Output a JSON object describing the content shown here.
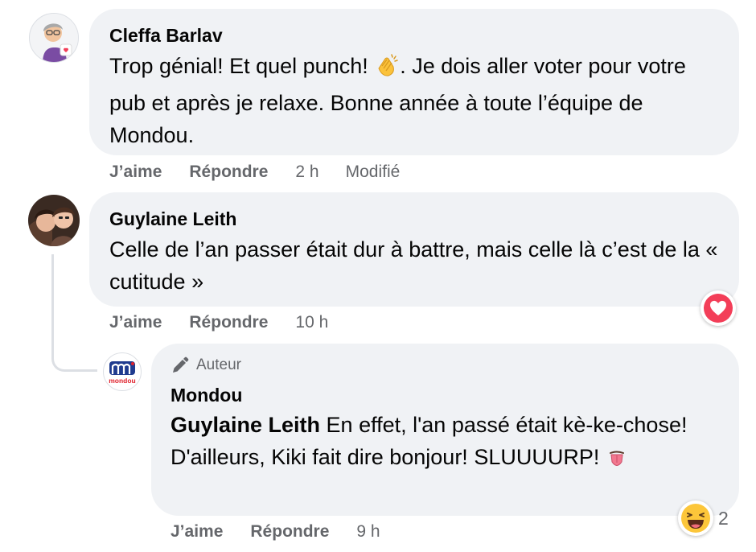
{
  "comments": [
    {
      "author": "Cleffa Barlav",
      "text_parts": [
        "Trop génial! Et quel punch! ",
        ". Je dois aller voter pour votre pub et après je relaxe. Bonne année à toute l’équipe de Mondou."
      ],
      "inline_emoji": "clapping-hands",
      "like_label": "J’aime",
      "reply_label": "Répondre",
      "time": "2 h",
      "edited_label": "Modifié"
    },
    {
      "author": "Guylaine Leith",
      "text": "Celle de l’an passer était dur à battre, mais celle là c’est de la « cutitude »",
      "like_label": "J’aime",
      "reply_label": "Répondre",
      "time": "10 h",
      "reaction": "heart"
    }
  ],
  "reply": {
    "badge_icon": "pencil-icon",
    "badge_label": "Auteur",
    "author": "Mondou",
    "logo_text": "mondou",
    "mention": "Guylaine Leith",
    "text_parts": [
      " En effet, l'an passé était kè-ke-chose! D'ailleurs, Kiki fait dire bonjour! SLUUUURP! ",
      ""
    ],
    "inline_emoji": "tongue-face",
    "like_label": "J’aime",
    "reply_label": "Répondre",
    "time": "9 h",
    "reaction": "laughing-face",
    "reaction_count": "2"
  },
  "colors": {
    "bubble": "#f0f2f5",
    "meta_text": "#65676b",
    "heart": "#f33e58",
    "brand_blue": "#1f3b8f",
    "brand_red": "#e0202b"
  }
}
